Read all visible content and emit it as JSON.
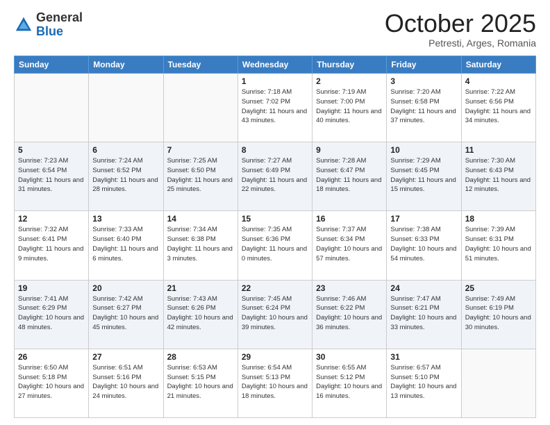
{
  "header": {
    "logo_general": "General",
    "logo_blue": "Blue",
    "month_title": "October 2025",
    "location": "Petresti, Arges, Romania"
  },
  "weekdays": [
    "Sunday",
    "Monday",
    "Tuesday",
    "Wednesday",
    "Thursday",
    "Friday",
    "Saturday"
  ],
  "weeks": [
    [
      {
        "day": "",
        "info": ""
      },
      {
        "day": "",
        "info": ""
      },
      {
        "day": "",
        "info": ""
      },
      {
        "day": "1",
        "info": "Sunrise: 7:18 AM\nSunset: 7:02 PM\nDaylight: 11 hours\nand 43 minutes."
      },
      {
        "day": "2",
        "info": "Sunrise: 7:19 AM\nSunset: 7:00 PM\nDaylight: 11 hours\nand 40 minutes."
      },
      {
        "day": "3",
        "info": "Sunrise: 7:20 AM\nSunset: 6:58 PM\nDaylight: 11 hours\nand 37 minutes."
      },
      {
        "day": "4",
        "info": "Sunrise: 7:22 AM\nSunset: 6:56 PM\nDaylight: 11 hours\nand 34 minutes."
      }
    ],
    [
      {
        "day": "5",
        "info": "Sunrise: 7:23 AM\nSunset: 6:54 PM\nDaylight: 11 hours\nand 31 minutes."
      },
      {
        "day": "6",
        "info": "Sunrise: 7:24 AM\nSunset: 6:52 PM\nDaylight: 11 hours\nand 28 minutes."
      },
      {
        "day": "7",
        "info": "Sunrise: 7:25 AM\nSunset: 6:50 PM\nDaylight: 11 hours\nand 25 minutes."
      },
      {
        "day": "8",
        "info": "Sunrise: 7:27 AM\nSunset: 6:49 PM\nDaylight: 11 hours\nand 22 minutes."
      },
      {
        "day": "9",
        "info": "Sunrise: 7:28 AM\nSunset: 6:47 PM\nDaylight: 11 hours\nand 18 minutes."
      },
      {
        "day": "10",
        "info": "Sunrise: 7:29 AM\nSunset: 6:45 PM\nDaylight: 11 hours\nand 15 minutes."
      },
      {
        "day": "11",
        "info": "Sunrise: 7:30 AM\nSunset: 6:43 PM\nDaylight: 11 hours\nand 12 minutes."
      }
    ],
    [
      {
        "day": "12",
        "info": "Sunrise: 7:32 AM\nSunset: 6:41 PM\nDaylight: 11 hours\nand 9 minutes."
      },
      {
        "day": "13",
        "info": "Sunrise: 7:33 AM\nSunset: 6:40 PM\nDaylight: 11 hours\nand 6 minutes."
      },
      {
        "day": "14",
        "info": "Sunrise: 7:34 AM\nSunset: 6:38 PM\nDaylight: 11 hours\nand 3 minutes."
      },
      {
        "day": "15",
        "info": "Sunrise: 7:35 AM\nSunset: 6:36 PM\nDaylight: 11 hours\nand 0 minutes."
      },
      {
        "day": "16",
        "info": "Sunrise: 7:37 AM\nSunset: 6:34 PM\nDaylight: 10 hours\nand 57 minutes."
      },
      {
        "day": "17",
        "info": "Sunrise: 7:38 AM\nSunset: 6:33 PM\nDaylight: 10 hours\nand 54 minutes."
      },
      {
        "day": "18",
        "info": "Sunrise: 7:39 AM\nSunset: 6:31 PM\nDaylight: 10 hours\nand 51 minutes."
      }
    ],
    [
      {
        "day": "19",
        "info": "Sunrise: 7:41 AM\nSunset: 6:29 PM\nDaylight: 10 hours\nand 48 minutes."
      },
      {
        "day": "20",
        "info": "Sunrise: 7:42 AM\nSunset: 6:27 PM\nDaylight: 10 hours\nand 45 minutes."
      },
      {
        "day": "21",
        "info": "Sunrise: 7:43 AM\nSunset: 6:26 PM\nDaylight: 10 hours\nand 42 minutes."
      },
      {
        "day": "22",
        "info": "Sunrise: 7:45 AM\nSunset: 6:24 PM\nDaylight: 10 hours\nand 39 minutes."
      },
      {
        "day": "23",
        "info": "Sunrise: 7:46 AM\nSunset: 6:22 PM\nDaylight: 10 hours\nand 36 minutes."
      },
      {
        "day": "24",
        "info": "Sunrise: 7:47 AM\nSunset: 6:21 PM\nDaylight: 10 hours\nand 33 minutes."
      },
      {
        "day": "25",
        "info": "Sunrise: 7:49 AM\nSunset: 6:19 PM\nDaylight: 10 hours\nand 30 minutes."
      }
    ],
    [
      {
        "day": "26",
        "info": "Sunrise: 6:50 AM\nSunset: 5:18 PM\nDaylight: 10 hours\nand 27 minutes."
      },
      {
        "day": "27",
        "info": "Sunrise: 6:51 AM\nSunset: 5:16 PM\nDaylight: 10 hours\nand 24 minutes."
      },
      {
        "day": "28",
        "info": "Sunrise: 6:53 AM\nSunset: 5:15 PM\nDaylight: 10 hours\nand 21 minutes."
      },
      {
        "day": "29",
        "info": "Sunrise: 6:54 AM\nSunset: 5:13 PM\nDaylight: 10 hours\nand 18 minutes."
      },
      {
        "day": "30",
        "info": "Sunrise: 6:55 AM\nSunset: 5:12 PM\nDaylight: 10 hours\nand 16 minutes."
      },
      {
        "day": "31",
        "info": "Sunrise: 6:57 AM\nSunset: 5:10 PM\nDaylight: 10 hours\nand 13 minutes."
      },
      {
        "day": "",
        "info": ""
      }
    ]
  ]
}
